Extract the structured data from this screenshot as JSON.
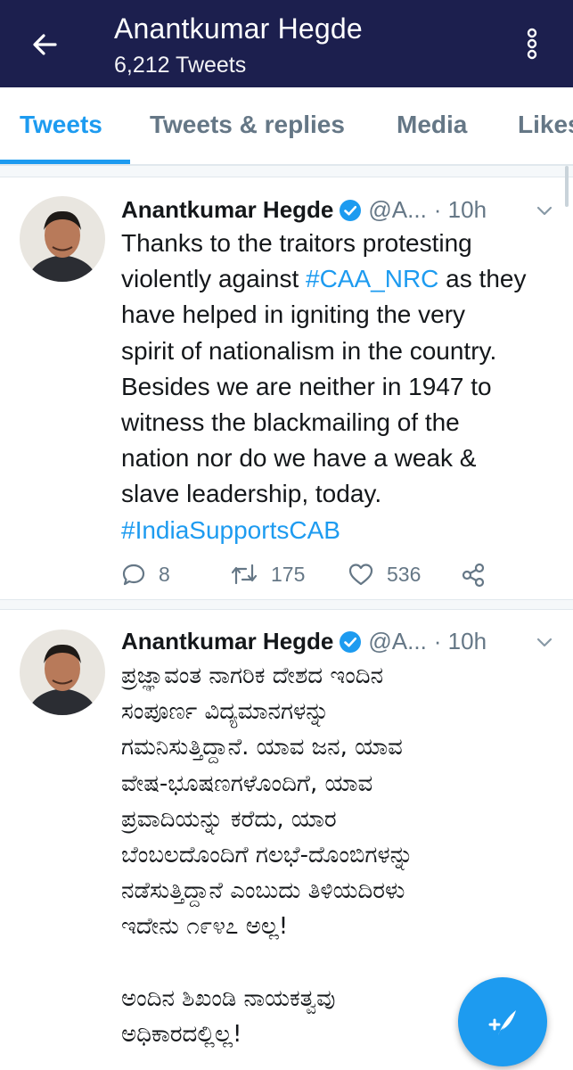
{
  "header": {
    "name": "Anantkumar Hegde",
    "tweet_count": "6,212 Tweets",
    "back_icon": "arrow-left-icon",
    "more_icon": "vertical-dots-icon",
    "background": "#1c1f4e"
  },
  "tabs": [
    {
      "label": "Tweets",
      "active": true
    },
    {
      "label": "Tweets & replies",
      "active": false
    },
    {
      "label": "Media",
      "active": false
    },
    {
      "label": "Likes",
      "active": false
    }
  ],
  "accent_color": "#1d9bf0",
  "tweets": [
    {
      "author": "Anantkumar Hegde",
      "handle": "@A...",
      "time": "· 10h",
      "lines": [
        {
          "pre": "Thanks to the traitors protesting"
        },
        {
          "pre": "violently against ",
          "tag": "#CAA_NRC",
          "post": " as they"
        },
        {
          "pre": "have helped in igniting the very"
        },
        {
          "pre": "spirit of nationalism in the country."
        },
        {
          "pre": "Besides we are neither in 1947 to"
        },
        {
          "pre": "witness the blackmailing of the"
        },
        {
          "pre": "nation nor do we have a weak &"
        },
        {
          "pre": "slave leadership, today."
        },
        {
          "tag": "#IndiaSupportsCAB"
        }
      ],
      "replies": "8",
      "retweets": "175",
      "likes": "536"
    },
    {
      "author": "Anantkumar Hegde",
      "handle": "@A...",
      "time": "· 10h",
      "lines": [
        {
          "pre": "ಪ್ರಜ್ಞಾವಂತ ನಾಗರಿಕ ದೇಶದ ಇಂದಿನ"
        },
        {
          "pre": "ಸಂಪೂರ್ಣ ವಿದ್ಯಮಾನಗಳನ್ನು"
        },
        {
          "pre": "ಗಮನಿಸುತ್ತಿದ್ದಾನೆ.  ಯಾವ ಜನ, ಯಾವ"
        },
        {
          "pre": "ವೇಷ-ಭೂಷಣಗಳೊಂದಿಗೆ, ಯಾವ"
        },
        {
          "pre": "ಪ್ರವಾದಿಯನ್ನು ಕರೆದು, ಯಾರ"
        },
        {
          "pre": "ಬೆಂಬಲದೊಂದಿಗೆ ಗಲಭೆ-ದೊಂಬಿಗಳನ್ನು"
        },
        {
          "pre": "ನಡೆಸುತ್ತಿದ್ದಾನೆ ಎಂಬುದು ತಿಳಿಯದಿರಳು"
        },
        {
          "pre": "ಇದೇನು ೧೯೪೭ ಅಲ್ಲ!"
        },
        {
          "pre": ""
        },
        {
          "pre": "ಅಂದಿನ ಶಿಖಂಡಿ ನಾಯಕತ್ವವು"
        },
        {
          "pre": "ಅಧಿಕಾರದಲ್ಲಿಲ್ಲ!"
        }
      ]
    }
  ],
  "fab_icon": "compose-feather-icon"
}
